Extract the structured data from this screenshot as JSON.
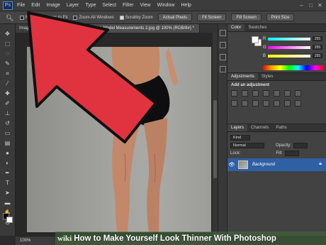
{
  "app": {
    "logo": "Ps"
  },
  "menu": [
    "File",
    "Edit",
    "Image",
    "Layer",
    "Type",
    "Select",
    "Filter",
    "View",
    "Window",
    "Help"
  ],
  "options": {
    "checkboxes": [
      "Resize Windows to Fit",
      "Zoom All Windows",
      "Scrubby Zoom"
    ],
    "buttons": [
      "Actual Pixels",
      "Fit Screen",
      "Fill Screen",
      "Print Size"
    ]
  },
  "doc_tabs": [
    "Image",
    "Plus Size Model Measurements 2.jpg @ 100% (RGB/8#) *"
  ],
  "color_panel": {
    "tabs": [
      "Color",
      "Swatches"
    ],
    "channels": [
      {
        "label": "R",
        "value": "255"
      },
      {
        "label": "G",
        "value": "255"
      },
      {
        "label": "B",
        "value": "255"
      }
    ]
  },
  "adjustments_panel": {
    "tabs": [
      "Adjustments",
      "Styles"
    ],
    "title": "Add an adjustment"
  },
  "layers_panel": {
    "tabs": [
      "Layers",
      "Channels",
      "Paths"
    ],
    "filter_kind": "Kind",
    "blend_mode": "Normal",
    "opacity_label": "Opacity:",
    "lock_label": "Lock:",
    "fill_label": "Fill:",
    "layer_name": "Background"
  },
  "status": {
    "zoom": "100%"
  },
  "caption": {
    "wiki": "wiki",
    "title": "How to Make Yourself Look Thinner With Photoshop"
  },
  "colors": {
    "arrow": "#e0333f",
    "selected_layer": "#2f5fa5"
  }
}
